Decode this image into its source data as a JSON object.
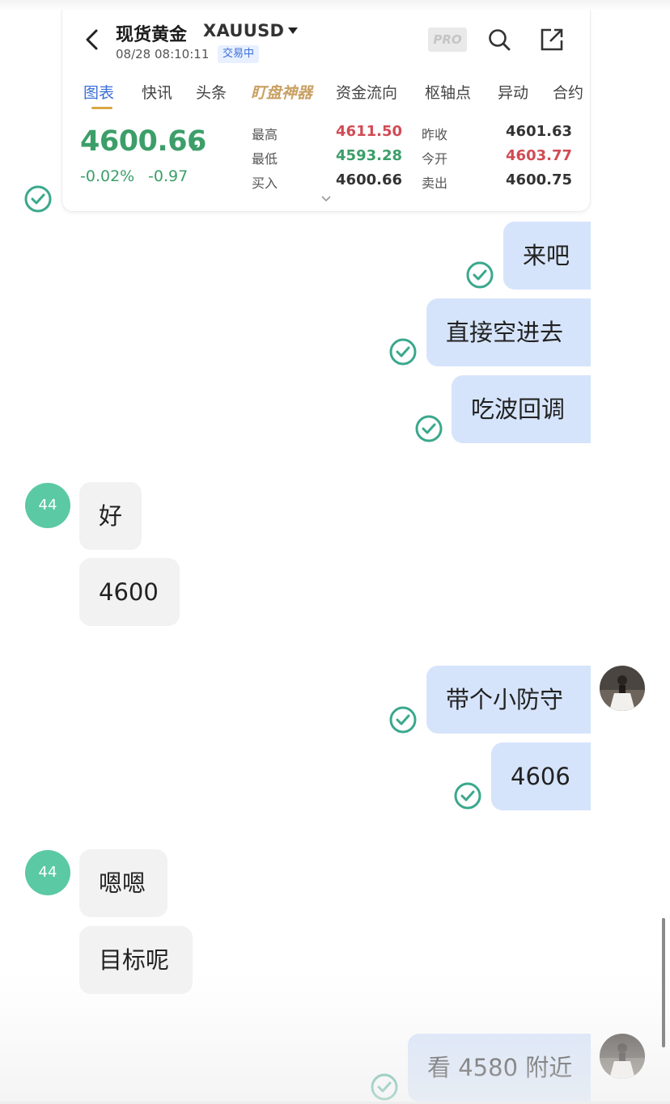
{
  "quote_card": {
    "title": "现货黄金",
    "symbol": "XAUUSD",
    "datetime": "08/28 08:10:11",
    "status": "交易中",
    "pro_label": "PRO",
    "tabs": [
      "图表",
      "快讯",
      "头条",
      "盯盘神器",
      "资金流向",
      "枢轴点",
      "异动",
      "合约"
    ],
    "active_tab": "图表",
    "price": "4600.66",
    "change_pct": "-0.02%",
    "change_amt": "-0.97",
    "stats": {
      "high_label": "最高",
      "high": "4611.50",
      "low_label": "最低",
      "low": "4593.28",
      "bid_label": "买入",
      "bid": "4600.66",
      "prev_close_label": "昨收",
      "prev_close": "4601.63",
      "open_label": "今开",
      "open": "4603.77",
      "ask_label": "卖出",
      "ask": "4600.75"
    },
    "colors": {
      "up": "#d14b55",
      "down": "#3c9e69",
      "accent": "#3b6fd8"
    }
  },
  "contact_avatar_label": "44",
  "messages": [
    {
      "dir": "out",
      "text": "来吧",
      "read": true
    },
    {
      "dir": "out",
      "text": "直接空进去",
      "read": true
    },
    {
      "dir": "out",
      "text": "吃波回调",
      "read": true
    },
    {
      "dir": "in",
      "text": "好"
    },
    {
      "dir": "in",
      "text": "4600"
    },
    {
      "dir": "out",
      "text": "带个小防守",
      "read": true
    },
    {
      "dir": "out",
      "text": "4606",
      "read": true
    },
    {
      "dir": "in",
      "text": "嗯嗯"
    },
    {
      "dir": "in",
      "text": "目标呢"
    },
    {
      "dir": "out",
      "text": "看 4580 附近",
      "read": true
    }
  ],
  "colors": {
    "outgoing_bubble": "#d6e4fb",
    "incoming_bubble": "#f2f2f2",
    "read_check": "#3aa88c",
    "contact_avatar": "#5bc9a4"
  }
}
